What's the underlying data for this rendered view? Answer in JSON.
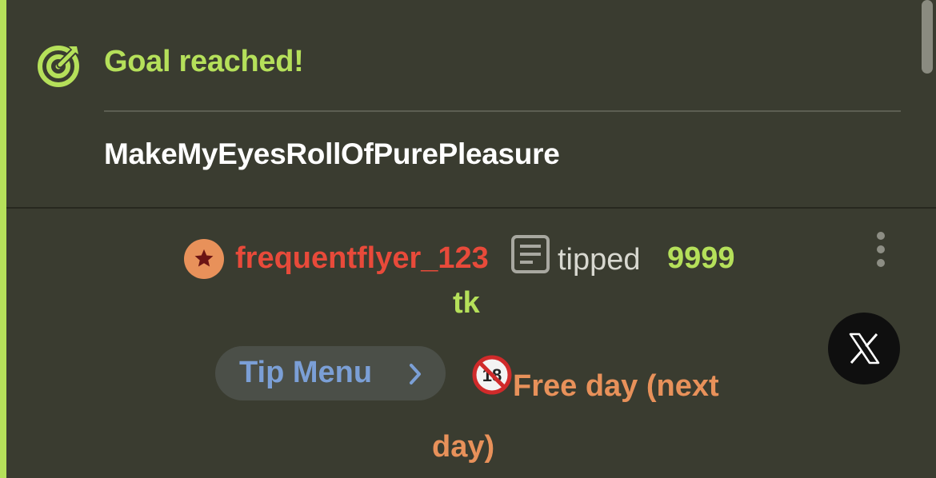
{
  "goal": {
    "title": "Goal reached!",
    "name": "MakeMyEyesRollOfPurePleasure"
  },
  "tip_event": {
    "username": "frequentflyer_123",
    "action": "tipped",
    "amount": "9999",
    "unit": "tk"
  },
  "tip_menu": {
    "label": "Tip Menu"
  },
  "menu_item": {
    "icon_glyph": "🔞",
    "text": "Free day (next day)"
  },
  "colors": {
    "accent": "#b5e05a",
    "username": "#e84a3a",
    "menu_item": "#e8915a",
    "tip_menu_label": "#7b9fd6",
    "background": "#3a3c30"
  }
}
